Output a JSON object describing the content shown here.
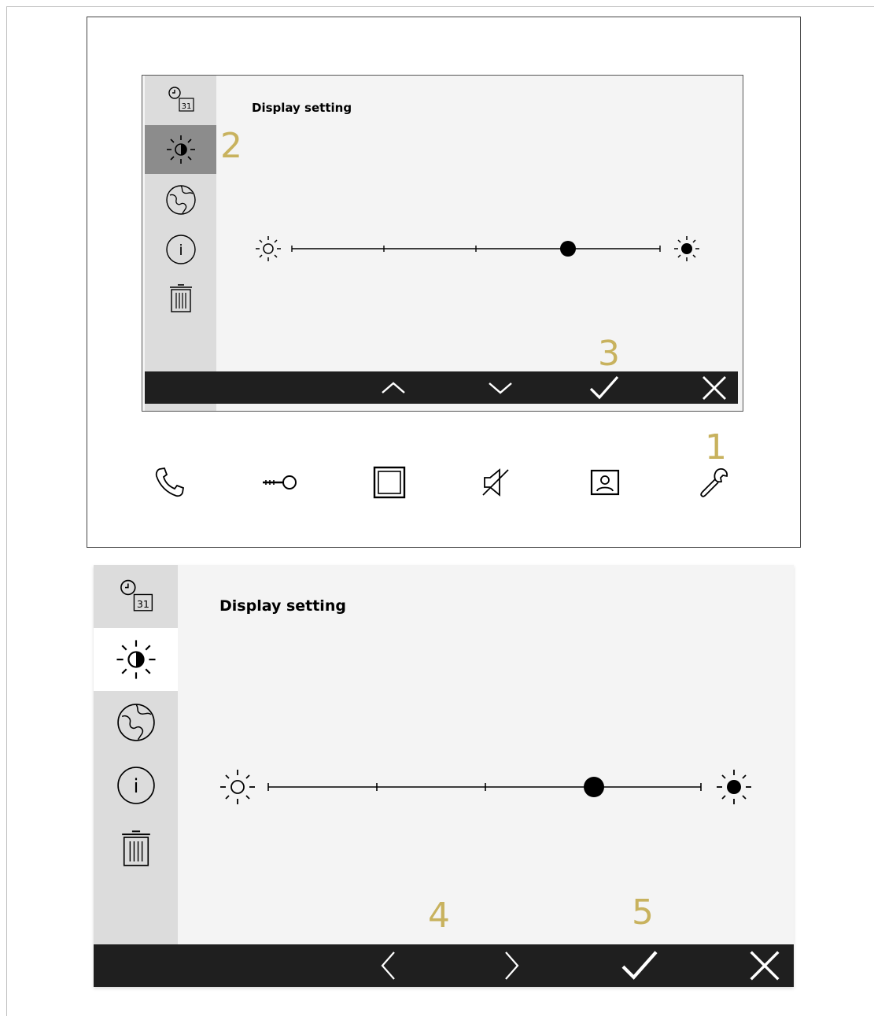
{
  "small_screen": {
    "title": "Display setting",
    "sidebar": [
      {
        "icon": "clock-calendar-icon",
        "day": "31",
        "active": false
      },
      {
        "icon": "brightness-icon",
        "active": true
      },
      {
        "icon": "globe-icon",
        "active": false
      },
      {
        "icon": "info-icon",
        "label": "i",
        "active": false
      },
      {
        "icon": "trash-icon",
        "active": false
      }
    ],
    "brightness_level": 0.75,
    "bottombar": [
      "up-arrow-icon",
      "down-arrow-icon",
      "checkmark-icon",
      "close-icon"
    ]
  },
  "large_screen": {
    "title": "Display setting",
    "sidebar": [
      {
        "icon": "clock-calendar-icon",
        "day": "31",
        "active": false
      },
      {
        "icon": "brightness-icon",
        "active": true
      },
      {
        "icon": "globe-icon",
        "active": false
      },
      {
        "icon": "info-icon",
        "label": "i",
        "active": false
      },
      {
        "icon": "trash-icon",
        "active": false
      }
    ],
    "brightness_level": 0.75,
    "bottombar": [
      "left-arrow-icon",
      "right-arrow-icon",
      "checkmark-icon",
      "close-icon"
    ]
  },
  "hardware_buttons": [
    "phone-icon",
    "key-icon",
    "square-icon",
    "mute-icon",
    "monitor-icon",
    "wrench-icon"
  ],
  "callouts": {
    "c1": "1",
    "c2": "2",
    "c3": "3",
    "c4": "4",
    "c5": "5"
  },
  "colors": {
    "callout": "#c8b25e",
    "bar": "#1f1f1f",
    "active_item_small": "#8c8c8c",
    "sidebar": "#dcdcdc"
  }
}
